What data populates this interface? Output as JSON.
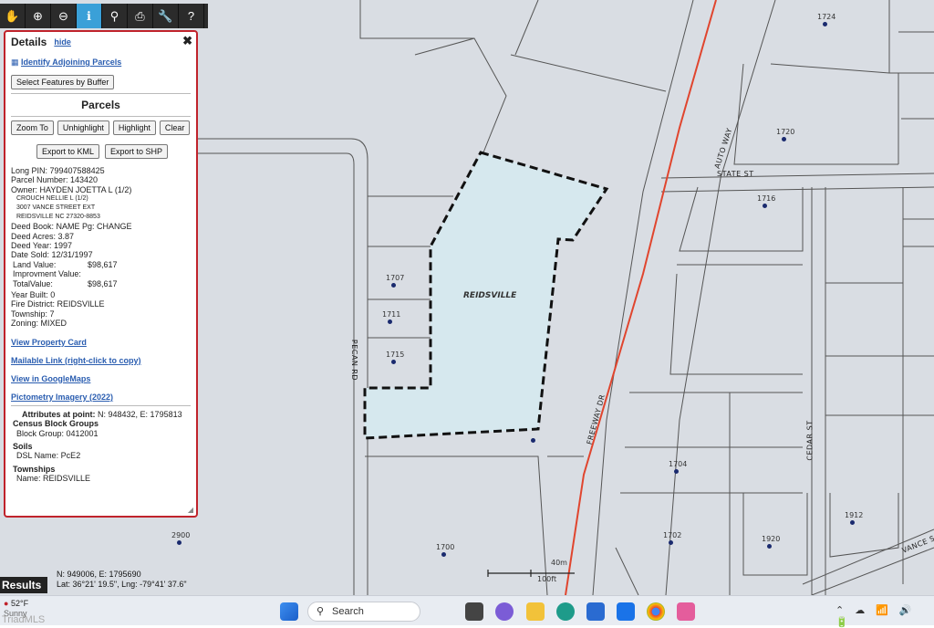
{
  "toolbar": {
    "tools": [
      "pan-icon",
      "zoom-in-icon",
      "zoom-out-icon",
      "info-icon",
      "search-icon",
      "print-icon",
      "wrench-icon",
      "help-icon"
    ]
  },
  "panel": {
    "title": "Details",
    "hide": "hide",
    "identify": "Identify Adjoining Parcels",
    "buffer_btn": "Select Features by Buffer",
    "parcels": "Parcels",
    "buttons": [
      "Zoom To",
      "Unhighlight",
      "Highlight",
      "Clear"
    ],
    "export_kml": "Export to KML",
    "export_shp": "Export to SHP",
    "long_pin": "Long PIN: 799407588425",
    "parcel_number": "Parcel Number: 143420",
    "owner": "Owner: HAYDEN JOETTA L (1/2)",
    "owner2": "CROUCH NELLIE L (1/2)",
    "addr1": "3007 VANCE STREET EXT",
    "addr2": "REIDSVILLE NC 27320-8853",
    "deed_book": "Deed Book: NAME Pg: CHANGE",
    "deed_acres": "Deed Acres: 3.87",
    "deed_year": "Deed Year: 1997",
    "date_sold": "Date Sold: 12/31/1997",
    "land_label": "Land Value:",
    "land_value": "$98,617",
    "impr_label": "Improvment Value:",
    "total_label": "TotalValue:",
    "total_value": "$98,617",
    "year_built": "Year Built: 0",
    "fire": "Fire District: REIDSVILLE",
    "township": "Township: 7",
    "zoning": "Zoning: MIXED",
    "links": [
      "View Property Card",
      "Mailable Link (right-click to copy)",
      "View in GoogleMaps",
      "Pictometry Imagery (2022)"
    ],
    "attrs_label": "Attributes at point:",
    "attrs_value": "N: 948432, E: 1795813",
    "census": "Census Block Groups",
    "block_group": "Block Group: 0412001",
    "soils": "Soils",
    "dsl": "DSL Name: PcE2",
    "townships": "Townships",
    "tname": "Name: REIDSVILLE"
  },
  "map": {
    "parcel_label": "REIDSVILLE",
    "streets": {
      "pecan": "PECAN RD",
      "freeway": "FREEWAY DR",
      "auto": "AUTO WAY",
      "state": "STATE ST",
      "cedar": "CEDAR ST",
      "vance": "VANCE S"
    },
    "parcels": [
      "1724",
      "1720",
      "1716",
      "1707",
      "1711",
      "1715",
      "1704",
      "1702",
      "1920",
      "1912",
      "1700",
      "2900"
    ],
    "scale_m": "40m",
    "scale_ft": "100ft"
  },
  "coords": {
    "ne": "N: 949006, E: 1795690",
    "latlng": "Lat: 36°21' 19.5\", Lng: -79°41' 37.6\""
  },
  "results": "Results",
  "taskbar": {
    "weather": "52°F",
    "weather_sub": "Sunny",
    "search": "Search",
    "watermark": "TriadMLS"
  }
}
